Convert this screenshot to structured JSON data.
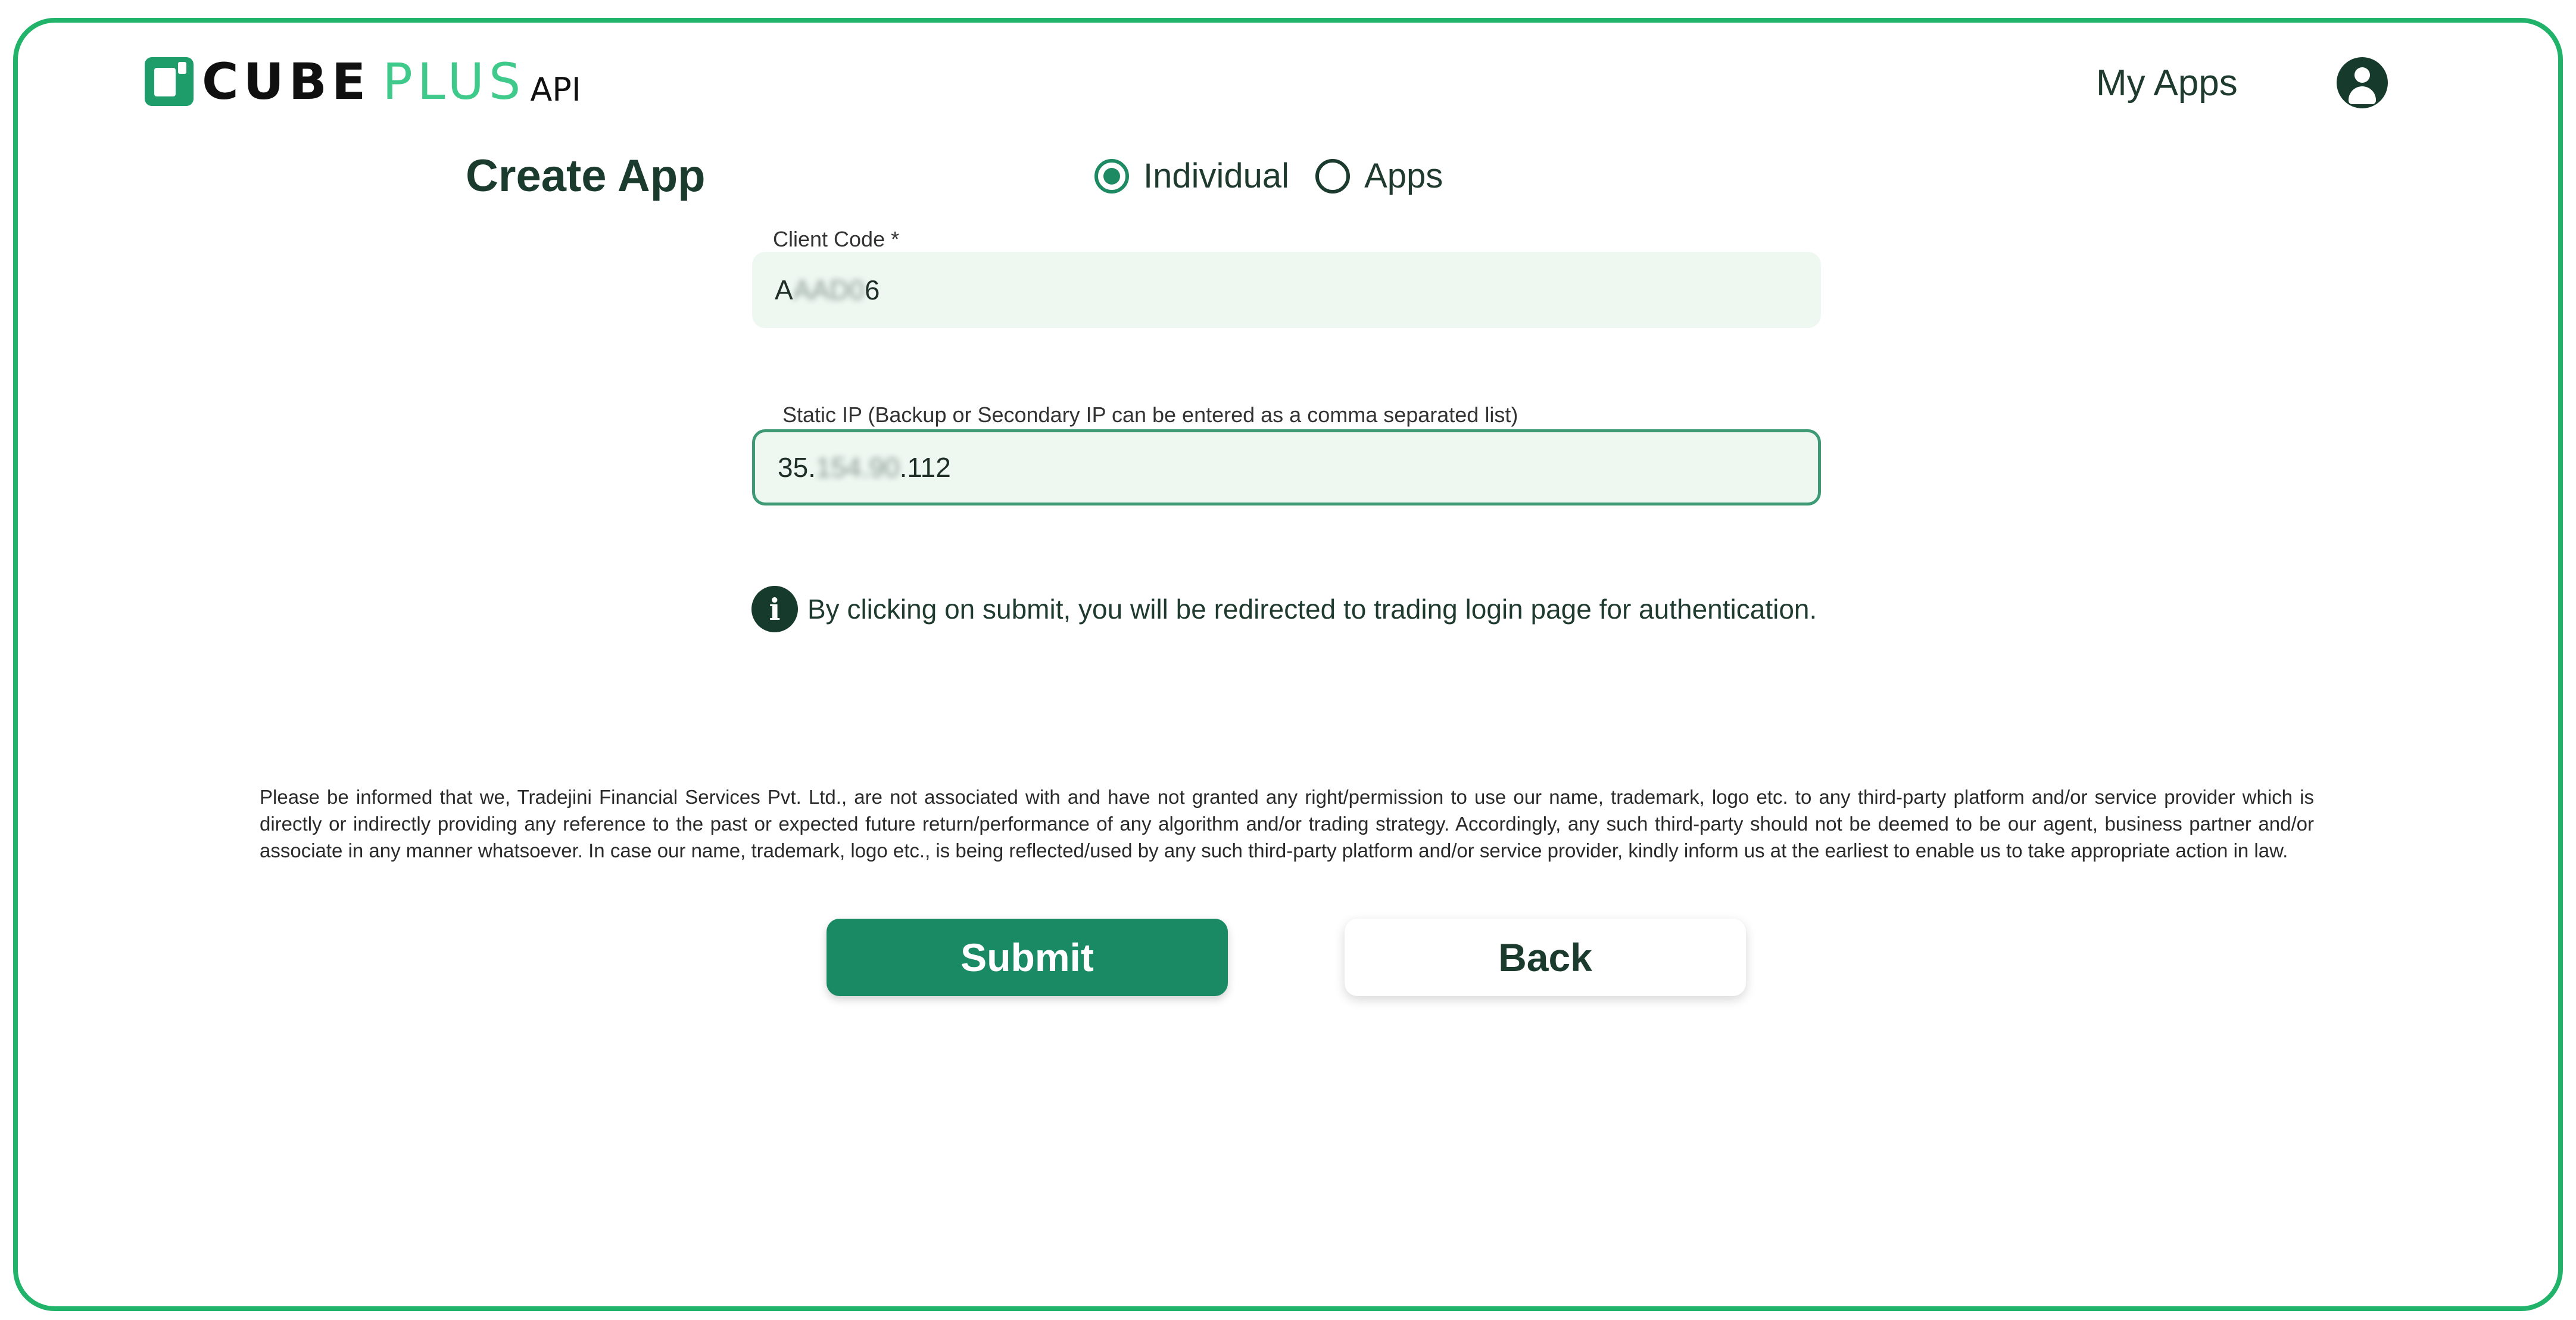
{
  "header": {
    "logo": {
      "part1": "CUBE",
      "part2": "PLUS",
      "part3": "API"
    },
    "nav_my_apps": "My Apps",
    "avatar_icon": "user-circle-icon"
  },
  "form": {
    "title": "Create App",
    "radio_options": [
      {
        "label": "Individual",
        "checked": true
      },
      {
        "label": "Apps",
        "checked": false
      }
    ],
    "client_code": {
      "label": "Client Code *",
      "value_prefix": "A",
      "value_masked": "AAD0",
      "value_suffix": "6"
    },
    "static_ip": {
      "label": "Static IP (Backup or Secondary IP can be entered as a comma separated list)",
      "value_prefix": "35.",
      "value_masked": "154.90",
      "value_suffix": ".112"
    },
    "info_text": "By clicking on submit, you will be redirected to trading login page for authentication.",
    "info_icon": "info-icon"
  },
  "disclaimer": "Please be informed that we, Tradejini Financial Services Pvt. Ltd., are not associated with and have not granted any right/permission to use our name, trademark, logo etc. to any third-party platform and/or service provider which is directly or indirectly providing any reference to the past or expected future return/performance of any algorithm and/or trading strategy. Accordingly, any such third-party should not be deemed to be our agent, business partner and/or associate in any manner whatsoever. In case our name, trademark, logo etc., is being reflected/used by any such third-party platform and/or service provider, kindly inform us at the earliest to enable us to take appropriate action in law.",
  "buttons": {
    "submit": "Submit",
    "back": "Back"
  },
  "colors": {
    "border": "#22b36a",
    "primary": "#1a8a64",
    "field_bg": "#eef8f1",
    "text_dark": "#1c3b2f"
  }
}
